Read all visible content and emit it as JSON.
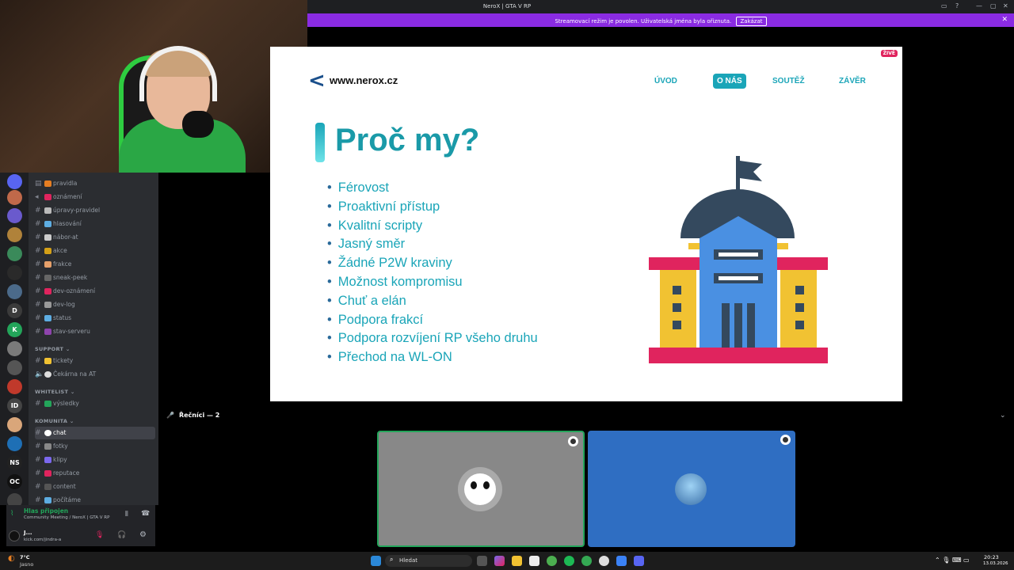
{
  "window": {
    "title": "NeroX | GTA V RP"
  },
  "banner": {
    "text": "Streamovací režim je povolen. Uživatelská jména byla ořiznuta.",
    "button": "Zakázat"
  },
  "slide": {
    "live_badge": "ŽIVĚ",
    "site": "www.nerox.cz",
    "nav": [
      "ÚVOD",
      "O NÁS",
      "SOUTĚŽ",
      "ZÁVĚR"
    ],
    "nav_active": "O NÁS",
    "heading": "Proč my?",
    "bullets": [
      "Férovost",
      "Proaktivní přístup",
      "Kvalitní scripty",
      "Jasný směr",
      "Žádné P2W kraviny",
      "Možnost kompromisu",
      "Chuť a elán",
      "Podpora frakcí",
      "Podpora rozvíjení RP všeho druhu",
      "Přechod na WL-ON"
    ]
  },
  "channels": {
    "info": [
      {
        "name": "pravidla"
      },
      {
        "name": "oznámení"
      },
      {
        "name": "úpravy-pravidel"
      },
      {
        "name": "hlasování"
      },
      {
        "name": "nábor-at"
      },
      {
        "name": "akce"
      },
      {
        "name": "frakce"
      },
      {
        "name": "sneak-peek"
      },
      {
        "name": "dev-oznámení"
      },
      {
        "name": "dev-log"
      },
      {
        "name": "status"
      },
      {
        "name": "stav-serveru"
      }
    ],
    "support_label": "SUPPORT",
    "support": [
      {
        "name": "tickety"
      },
      {
        "name": "Čekárna na AT"
      }
    ],
    "whitelist_label": "WHITELIST",
    "whitelist": [
      {
        "name": "výsledky"
      }
    ],
    "komunita_label": "KOMUNITA",
    "komunita": [
      {
        "name": "chat",
        "selected": true
      },
      {
        "name": "fotky"
      },
      {
        "name": "klipy"
      },
      {
        "name": "reputace"
      },
      {
        "name": "content"
      },
      {
        "name": "počítáme"
      }
    ]
  },
  "voice": {
    "status": "Hlas připojen",
    "channel": "Community Meeting / NeroX | GTA V RP"
  },
  "user": {
    "name": "J...",
    "status": "kick.com/jindra-a"
  },
  "stage": {
    "speakers_label": "Řečníci — 2"
  },
  "taskbar": {
    "weather_temp": "7°C",
    "weather_desc": "Jasno",
    "search": "Hledat",
    "time": "20:23",
    "date": "13.03.2026"
  },
  "colors": {
    "banner": "#8a2be2",
    "accent": "#1aa5b8",
    "voice_connected": "#23a55a"
  }
}
